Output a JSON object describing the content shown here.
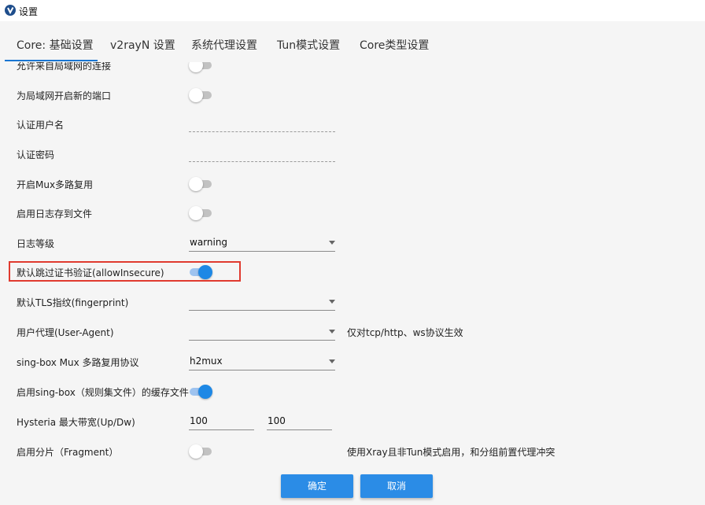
{
  "window": {
    "title": "设置",
    "icon": "v2rayn-app-icon"
  },
  "tabs": [
    {
      "label": "Core: 基础设置",
      "active": true
    },
    {
      "label": "v2rayN 设置",
      "active": false
    },
    {
      "label": "系统代理设置",
      "active": false
    },
    {
      "label": "Tun模式设置",
      "active": false
    },
    {
      "label": "Core类型设置",
      "active": false
    }
  ],
  "settings": {
    "allow_lan": {
      "label": "允许来自局域网的连接",
      "on": false
    },
    "lan_new_port": {
      "label": "为局域网开启新的端口",
      "on": false
    },
    "auth_user": {
      "label": "认证用户名",
      "value": ""
    },
    "auth_pass": {
      "label": "认证密码",
      "value": ""
    },
    "mux": {
      "label": "开启Mux多路复用",
      "on": false
    },
    "log_file": {
      "label": "启用日志存到文件",
      "on": false
    },
    "log_level": {
      "label": "日志等级",
      "value": "warning"
    },
    "allow_insecure": {
      "label": "默认跳过证书验证(allowInsecure)",
      "on": true
    },
    "tls_fingerprint": {
      "label": "默认TLS指纹(fingerprint)",
      "value": ""
    },
    "user_agent": {
      "label": "用户代理(User-Agent)",
      "value": "",
      "hint": "仅对tcp/http、ws协议生效"
    },
    "singbox_mux": {
      "label": "sing-box Mux 多路复用协议",
      "value": "h2mux"
    },
    "singbox_cache": {
      "label": "启用sing-box（规则集文件）的缓存文件",
      "on": true
    },
    "hysteria_bw": {
      "label": "Hysteria 最大带宽(Up/Dw)",
      "up": "100",
      "down": "100"
    },
    "fragment": {
      "label": "启用分片（Fragment）",
      "on": false,
      "hint": "使用Xray且非Tun模式启用，和分组前置代理冲突"
    }
  },
  "buttons": {
    "ok": "确定",
    "cancel": "取消"
  },
  "colors": {
    "accent": "#1e88e5",
    "highlight_border": "#e03a2f",
    "button": "#2b8ce6"
  }
}
